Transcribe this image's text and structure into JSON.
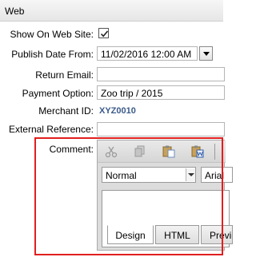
{
  "header": {
    "title": "Web"
  },
  "fields": {
    "show_on_web_site": {
      "label": "Show On Web Site:",
      "checked": true
    },
    "publish_date_from": {
      "label": "Publish Date From:",
      "value": "11/02/2016 12:00 AM"
    },
    "return_email": {
      "label": "Return Email:",
      "value": ""
    },
    "payment_option": {
      "label": "Payment Option:",
      "value": "Zoo trip / 2015"
    },
    "merchant_id": {
      "label": "Merchant ID:",
      "value": "XYZ0010"
    },
    "external_reference": {
      "label": "External Reference:",
      "value": ""
    },
    "comment": {
      "label": "Comment:"
    }
  },
  "editor": {
    "toolbar_icons": [
      "cut-icon",
      "copy-icon",
      "paste-icon",
      "paste-from-word-icon"
    ],
    "format_select": "Normal",
    "font_select": "Arial",
    "tabs": [
      "Design",
      "HTML",
      "Preview"
    ]
  },
  "colors": {
    "highlight": "#e21e1e",
    "merchant_text": "#3b5a8a"
  }
}
